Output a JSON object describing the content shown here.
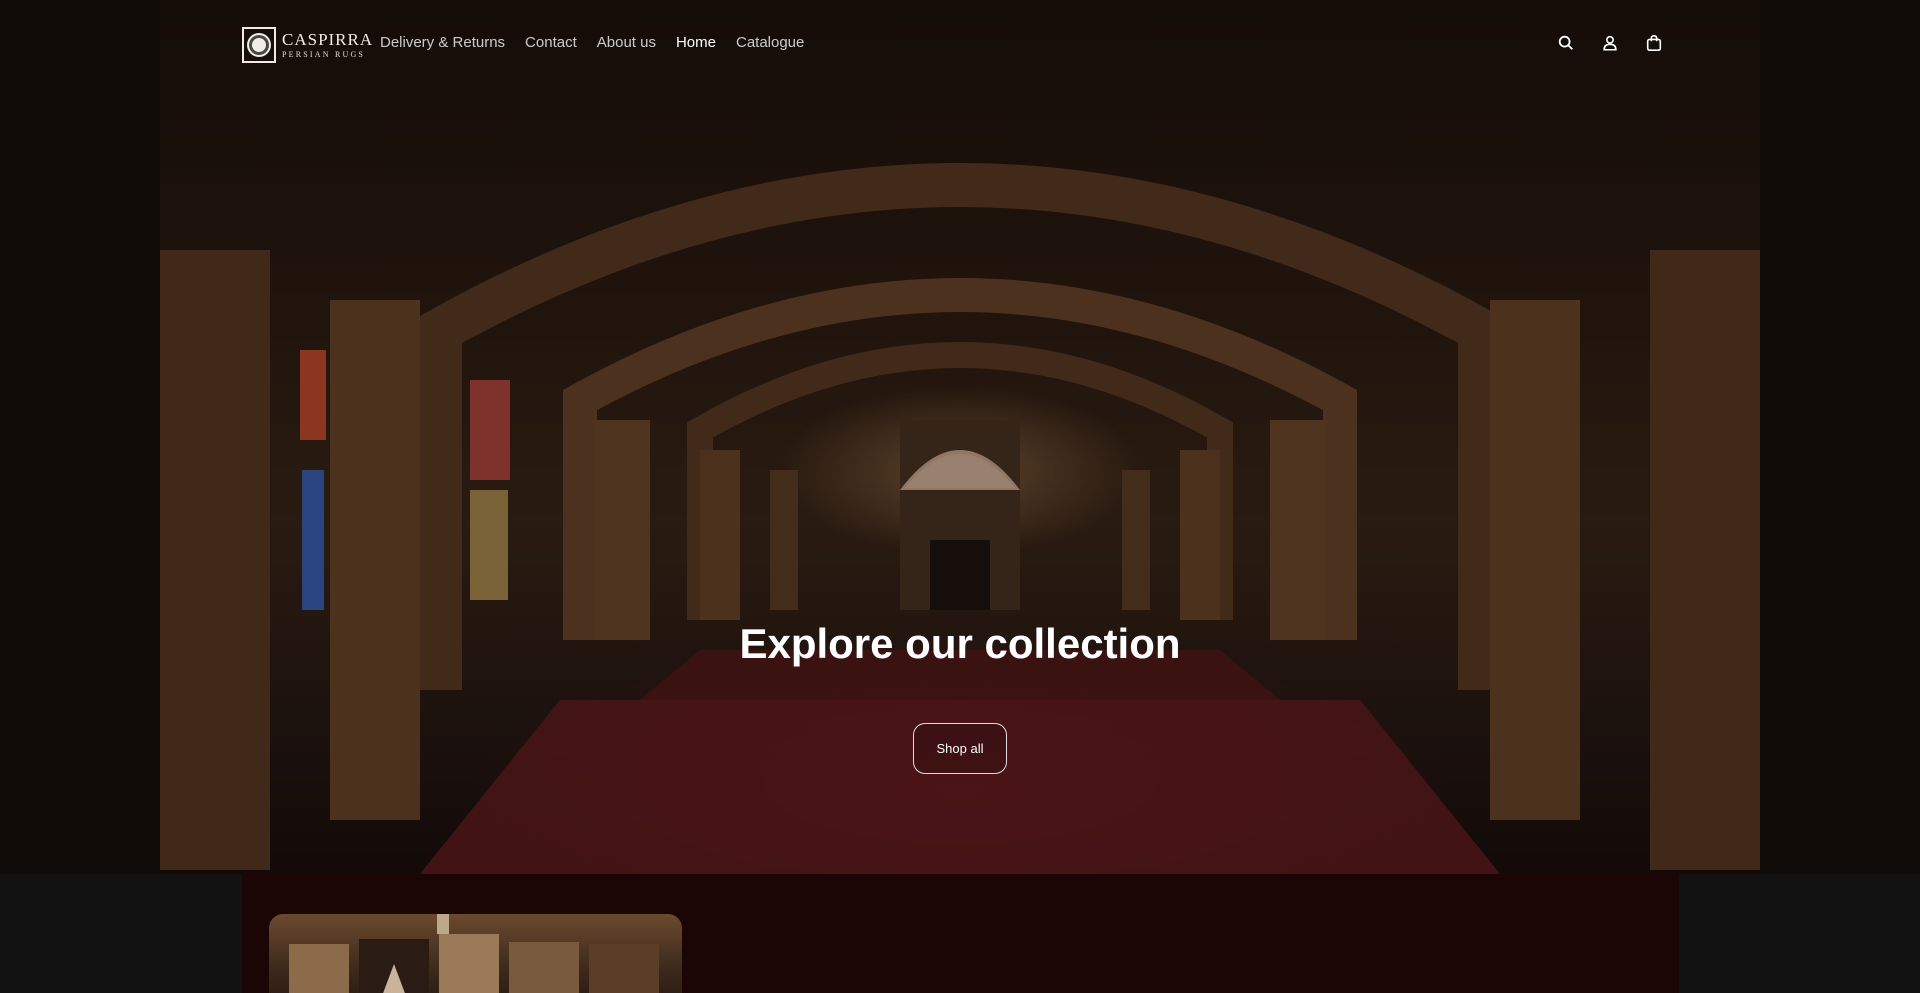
{
  "header": {
    "logo": {
      "name": "CASPIRRA",
      "subtitle": "PERSIAN RUGS"
    },
    "nav": [
      {
        "label": "Delivery & Returns",
        "active": false
      },
      {
        "label": "Contact",
        "active": false
      },
      {
        "label": "About us",
        "active": false
      },
      {
        "label": "Home",
        "active": true
      },
      {
        "label": "Catalogue",
        "active": false
      }
    ],
    "icons": [
      "search-icon",
      "account-icon",
      "cart-icon"
    ]
  },
  "hero": {
    "title": "Explore our collection",
    "button_label": "Shop all"
  },
  "colors": {
    "panel_bg": "#1c0605",
    "page_bg": "#121212",
    "text": "#ffffff"
  }
}
